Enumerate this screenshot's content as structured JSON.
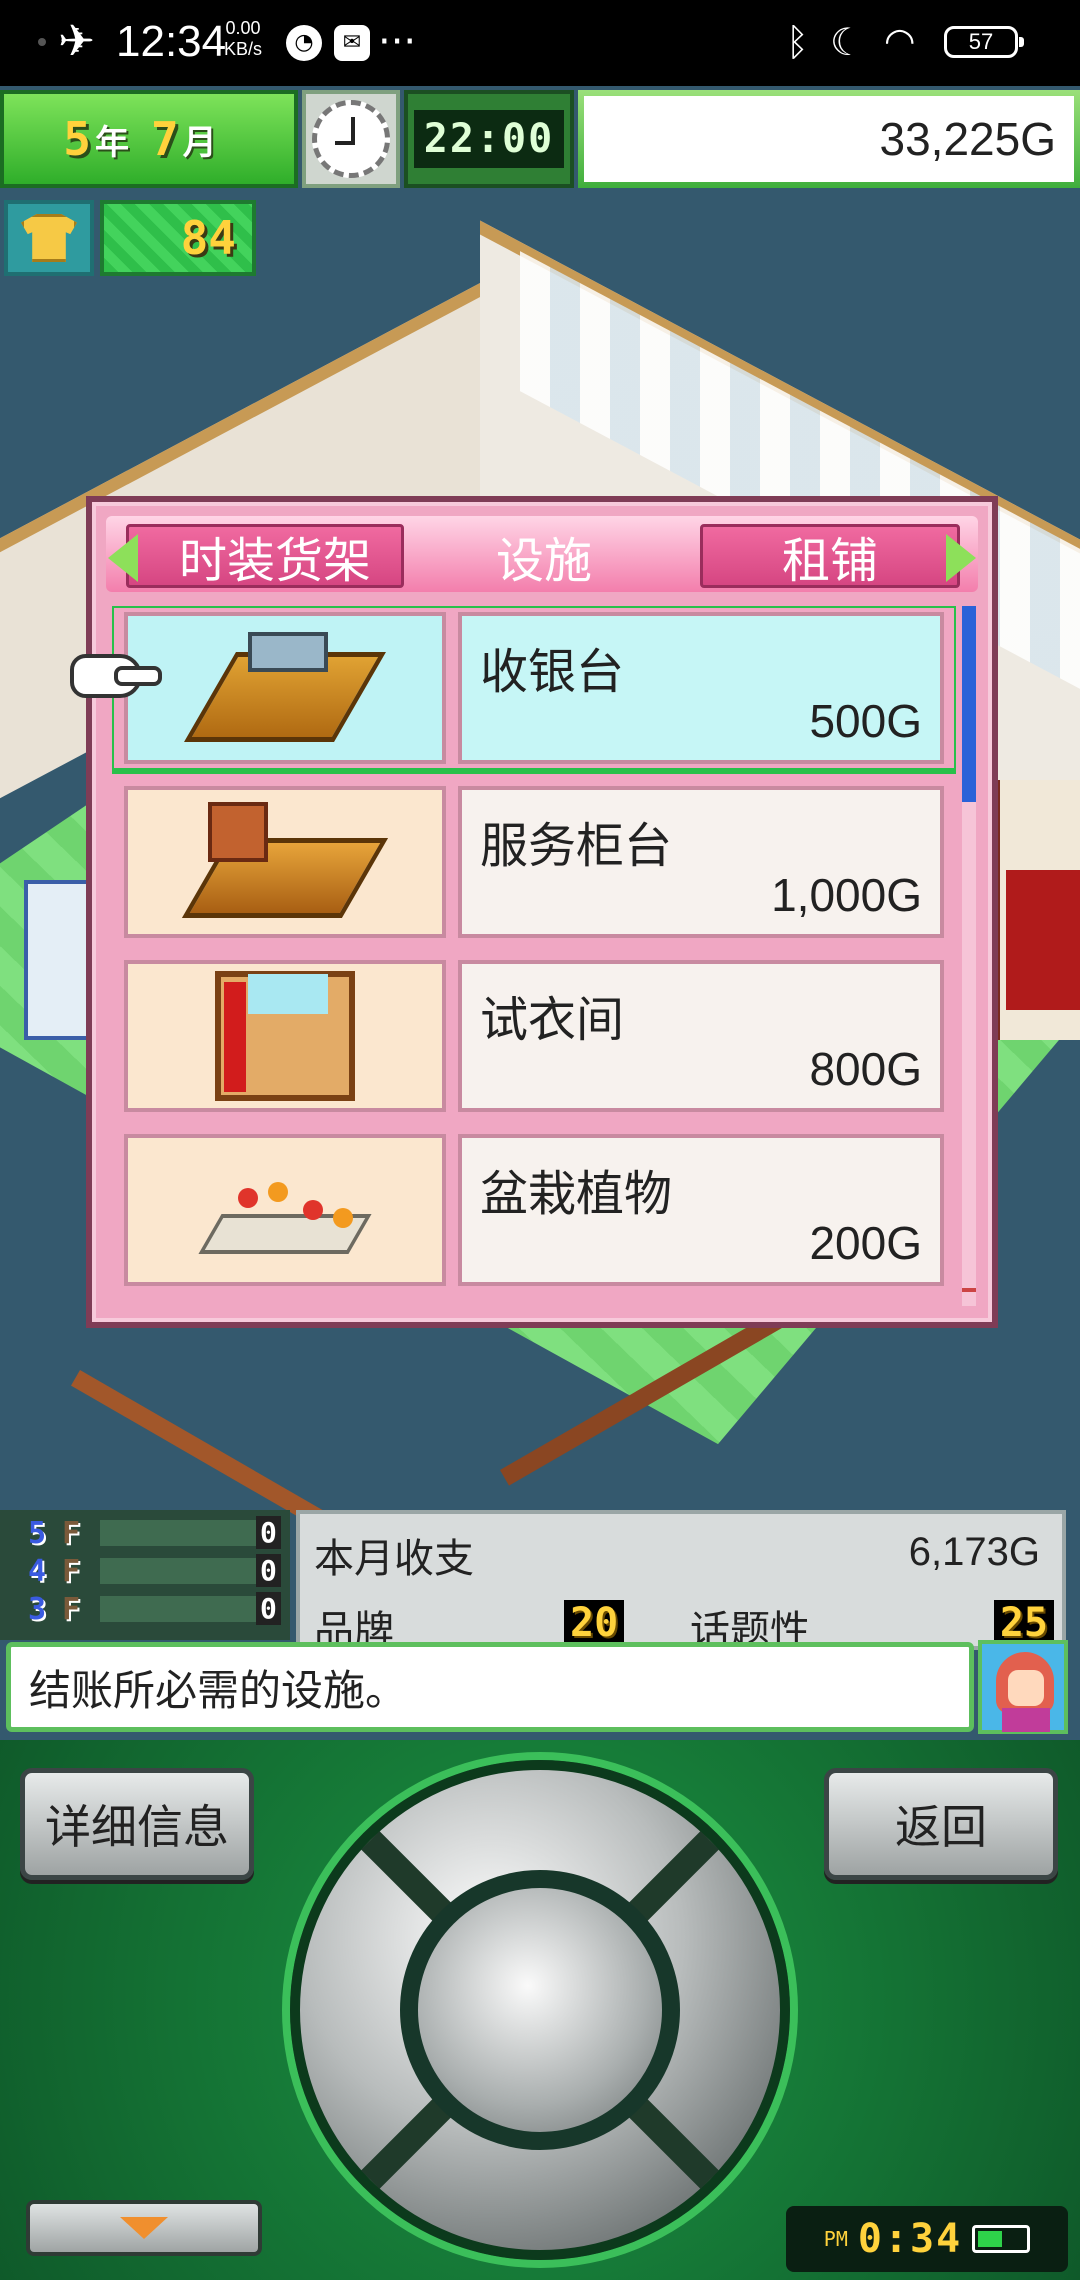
{
  "status_bar": {
    "time": "12:34",
    "speed_value": "0.00",
    "speed_unit": "KB/s",
    "battery": "57",
    "icons": [
      "airplane-icon",
      "speedometer-icon",
      "mail-icon",
      "more-icon",
      "bluetooth-icon",
      "moon-icon",
      "wifi-icon",
      "battery-icon"
    ]
  },
  "hud": {
    "year_num": "5",
    "year_unit": "年",
    "month_num": "7",
    "month_unit": "月",
    "time": "22:00",
    "money": "33,225G",
    "fans": "84"
  },
  "dialog": {
    "tab_prev": "时装货架",
    "tab_current": "设施",
    "tab_next": "租铺",
    "items": [
      {
        "name": "收银台",
        "price": "500G",
        "icon": "cash-register-icon",
        "selected": true
      },
      {
        "name": "服务柜台",
        "price": "1,000G",
        "icon": "service-counter-icon",
        "selected": false
      },
      {
        "name": "试衣间",
        "price": "800G",
        "icon": "fitting-room-icon",
        "selected": false
      },
      {
        "name": "盆栽植物",
        "price": "200G",
        "icon": "potted-plant-icon",
        "selected": false
      }
    ]
  },
  "floors": [
    {
      "level": "5",
      "suffix": "F",
      "value": "0"
    },
    {
      "level": "4",
      "suffix": "F",
      "value": "0"
    },
    {
      "level": "3",
      "suffix": "F",
      "value": "0"
    }
  ],
  "stats": {
    "monthly_label": "本月收支",
    "monthly_value": "6,173G",
    "brand_label": "品牌",
    "brand_value": "20",
    "topic_label": "话题性",
    "topic_value": "25"
  },
  "message": "结账所必需的设施。",
  "controls": {
    "detail_label": "详细信息",
    "back_label": "返回",
    "clock_ampm": "PM",
    "clock_time": "0:34"
  },
  "colors": {
    "dialog_pink": "#f0a7c3",
    "selection_green": "#29c04a",
    "hud_yellow": "#ffd23c"
  }
}
